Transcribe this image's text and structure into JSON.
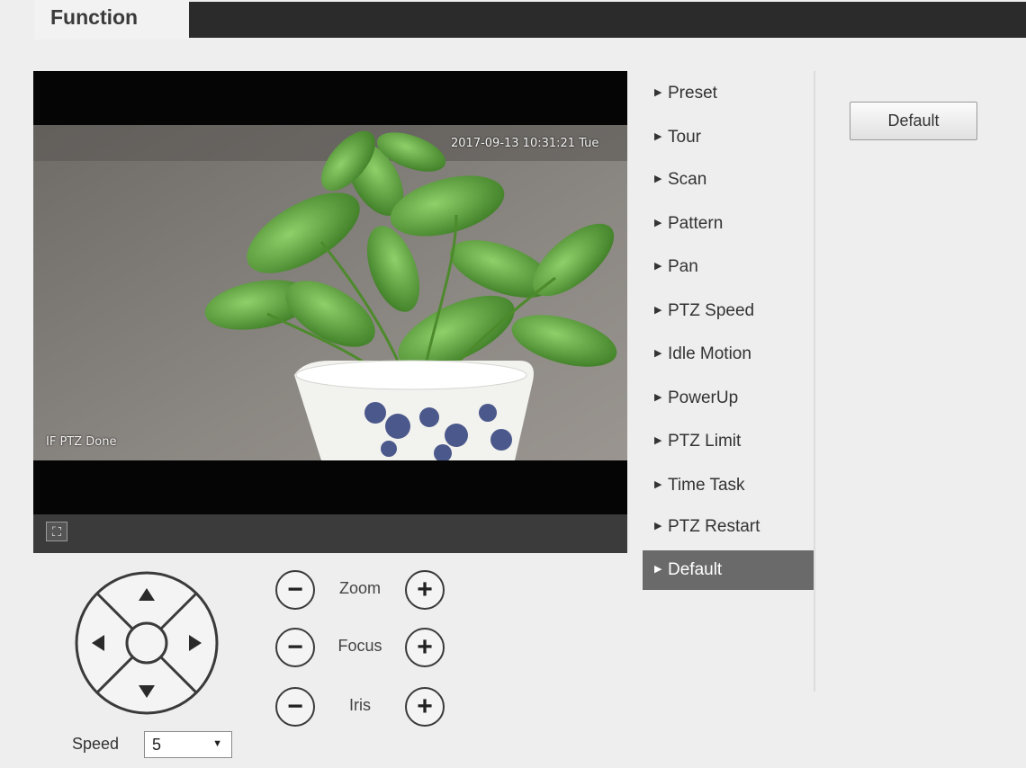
{
  "header": {
    "tab_label": "Function"
  },
  "video": {
    "timestamp": "2017-09-13 10:31:21 Tue",
    "status_text": "IF PTZ Done",
    "fullscreen_icon": "fullscreen-icon"
  },
  "menu": {
    "items": [
      {
        "label": "Preset",
        "active": false
      },
      {
        "label": "Tour",
        "active": false
      },
      {
        "label": "Scan",
        "active": false
      },
      {
        "label": "Pattern",
        "active": false
      },
      {
        "label": "Pan",
        "active": false
      },
      {
        "label": "PTZ Speed",
        "active": false
      },
      {
        "label": "Idle Motion",
        "active": false
      },
      {
        "label": "PowerUp",
        "active": false
      },
      {
        "label": "PTZ Limit",
        "active": false
      },
      {
        "label": "Time Task",
        "active": false
      },
      {
        "label": "PTZ Restart",
        "active": false
      },
      {
        "label": "Default",
        "active": true
      }
    ]
  },
  "default_button_label": "Default",
  "controls": {
    "zoom_label": "Zoom",
    "focus_label": "Focus",
    "iris_label": "Iris",
    "minus_symbol": "−",
    "plus_symbol": "+",
    "speed_label": "Speed",
    "speed_value": "5"
  },
  "colors": {
    "active_menu_bg": "#6a6a6a",
    "header_dark": "#2b2b2b"
  }
}
